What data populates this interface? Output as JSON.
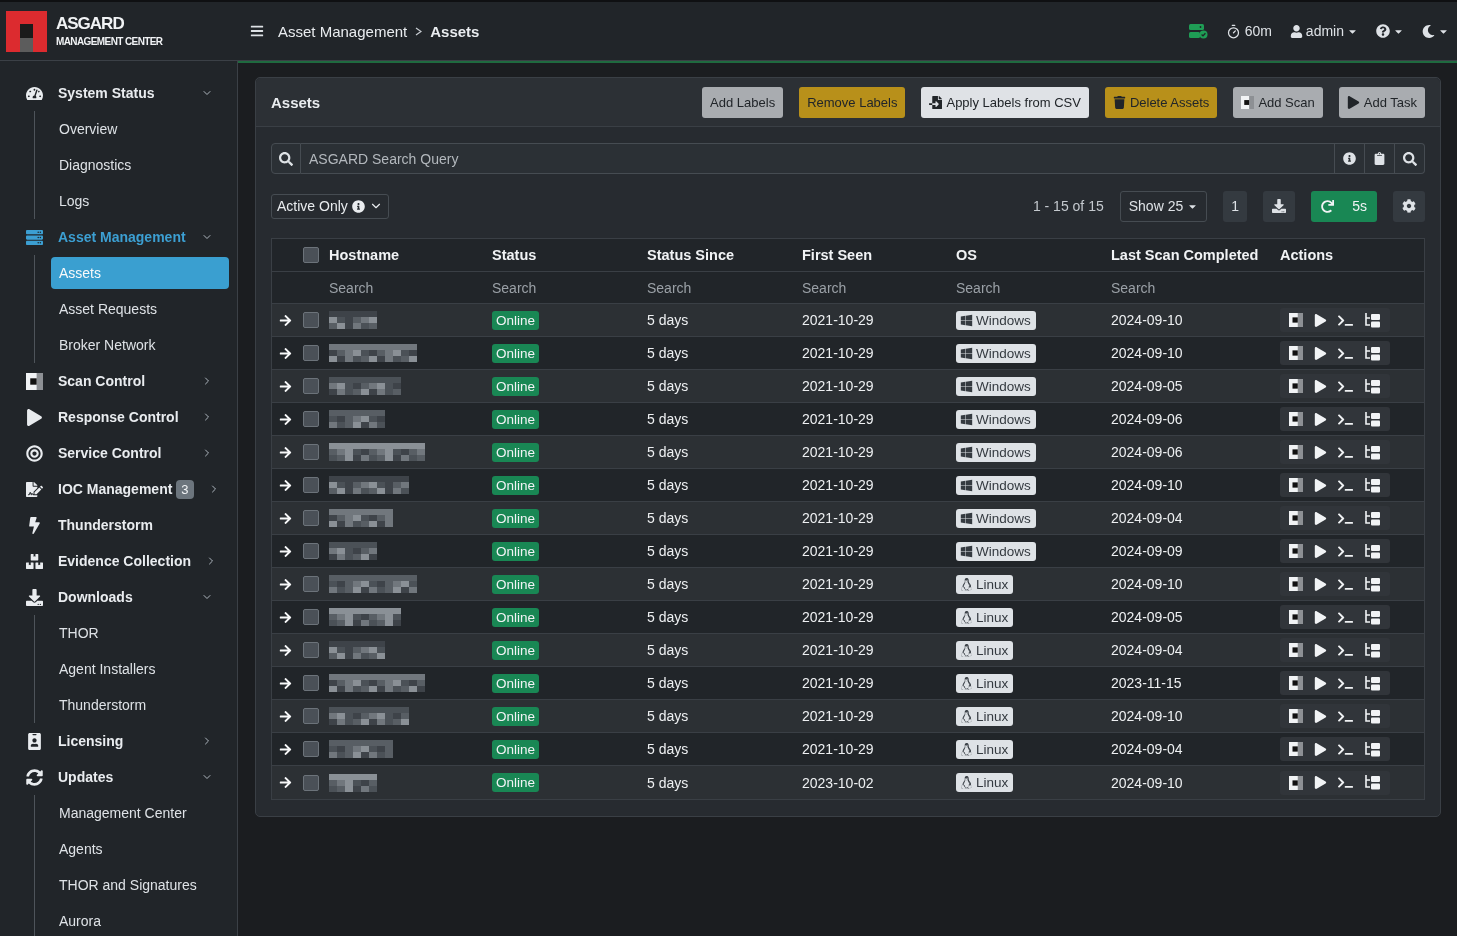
{
  "brand": {
    "title": "ASGARD",
    "subtitle": "MANAGEMENT CENTER"
  },
  "breadcrumb": [
    {
      "label": "Asset Management",
      "current": false
    },
    {
      "label": "Assets",
      "current": true
    }
  ],
  "header": {
    "timer": "60m",
    "user": "admin"
  },
  "sidebar": {
    "items": [
      {
        "label": "System Status",
        "selected": false,
        "expanded": true,
        "children": [
          {
            "label": "Overview",
            "selected": false
          },
          {
            "label": "Diagnostics",
            "selected": false
          },
          {
            "label": "Logs",
            "selected": false
          }
        ]
      },
      {
        "label": "Asset Management",
        "selected": true,
        "expanded": true,
        "children": [
          {
            "label": "Assets",
            "selected": true
          },
          {
            "label": "Asset Requests",
            "selected": false
          },
          {
            "label": "Broker Network",
            "selected": false
          }
        ]
      },
      {
        "label": "Scan Control",
        "selected": false,
        "expanded": false
      },
      {
        "label": "Response Control",
        "selected": false,
        "expanded": false
      },
      {
        "label": "Service Control",
        "selected": false,
        "expanded": false
      },
      {
        "label": "IOC Management",
        "selected": false,
        "expanded": false,
        "badge": "3"
      },
      {
        "label": "Thunderstorm",
        "selected": false
      },
      {
        "label": "Evidence Collection",
        "selected": false,
        "expanded": false
      },
      {
        "label": "Downloads",
        "selected": false,
        "expanded": true,
        "children": [
          {
            "label": "THOR",
            "selected": false
          },
          {
            "label": "Agent Installers",
            "selected": false
          },
          {
            "label": "Thunderstorm",
            "selected": false
          }
        ]
      },
      {
        "label": "Licensing",
        "selected": false,
        "expanded": false
      },
      {
        "label": "Updates",
        "selected": false,
        "expanded": true,
        "children": [
          {
            "label": "Management Center",
            "selected": false
          },
          {
            "label": "Agents",
            "selected": false
          },
          {
            "label": "THOR and Signatures",
            "selected": false
          },
          {
            "label": "Aurora",
            "selected": false
          }
        ]
      }
    ]
  },
  "panel": {
    "title": "Assets",
    "buttons": [
      {
        "label": "Add Labels",
        "kind": "secondary"
      },
      {
        "label": "Remove Labels",
        "kind": "warning"
      },
      {
        "label": "Apply Labels from CSV",
        "kind": "light"
      },
      {
        "label": "Delete Assets",
        "kind": "warning"
      },
      {
        "label": "Add Scan",
        "kind": "secondary"
      },
      {
        "label": "Add Task",
        "kind": "secondary"
      }
    ],
    "search": {
      "placeholder": "ASGARD Search Query"
    },
    "filter": {
      "value": "Active Only"
    },
    "range": "1 - 15 of 15",
    "page_size": "Show 25",
    "page": "1",
    "refresh": "5s"
  },
  "table": {
    "all_checked": false,
    "columns": [
      {
        "label": "Hostname",
        "placeholder": "Search"
      },
      {
        "label": "Status",
        "placeholder": "Search"
      },
      {
        "label": "Status Since",
        "placeholder": "Search"
      },
      {
        "label": "First Seen",
        "placeholder": "Search"
      },
      {
        "label": "OS",
        "placeholder": "Search"
      },
      {
        "label": "Last Scan Completed",
        "placeholder": "Search"
      },
      {
        "label": "Actions"
      }
    ],
    "rows": [
      {
        "checked": false,
        "status": "Online",
        "status_since": "5 days",
        "first_seen": "2021-10-29",
        "os": {
          "label": "Windows",
          "kind": "windows"
        },
        "last_scan": "2024-09-10"
      },
      {
        "checked": false,
        "status": "Online",
        "status_since": "5 days",
        "first_seen": "2021-10-29",
        "os": {
          "label": "Windows",
          "kind": "windows"
        },
        "last_scan": "2024-09-10"
      },
      {
        "checked": false,
        "status": "Online",
        "status_since": "5 days",
        "first_seen": "2021-10-29",
        "os": {
          "label": "Windows",
          "kind": "windows"
        },
        "last_scan": "2024-09-05"
      },
      {
        "checked": false,
        "status": "Online",
        "status_since": "5 days",
        "first_seen": "2021-10-29",
        "os": {
          "label": "Windows",
          "kind": "windows"
        },
        "last_scan": "2024-09-06"
      },
      {
        "checked": false,
        "status": "Online",
        "status_since": "5 days",
        "first_seen": "2021-10-29",
        "os": {
          "label": "Windows",
          "kind": "windows"
        },
        "last_scan": "2024-09-06"
      },
      {
        "checked": false,
        "status": "Online",
        "status_since": "5 days",
        "first_seen": "2021-10-29",
        "os": {
          "label": "Windows",
          "kind": "windows"
        },
        "last_scan": "2024-09-10"
      },
      {
        "checked": false,
        "status": "Online",
        "status_since": "5 days",
        "first_seen": "2021-10-29",
        "os": {
          "label": "Windows",
          "kind": "windows"
        },
        "last_scan": "2024-09-04"
      },
      {
        "checked": false,
        "status": "Online",
        "status_since": "5 days",
        "first_seen": "2021-10-29",
        "os": {
          "label": "Windows",
          "kind": "windows"
        },
        "last_scan": "2024-09-09"
      },
      {
        "checked": false,
        "status": "Online",
        "status_since": "5 days",
        "first_seen": "2021-10-29",
        "os": {
          "label": "Linux",
          "kind": "linux"
        },
        "last_scan": "2024-09-10"
      },
      {
        "checked": false,
        "status": "Online",
        "status_since": "5 days",
        "first_seen": "2021-10-29",
        "os": {
          "label": "Linux",
          "kind": "linux"
        },
        "last_scan": "2024-09-05"
      },
      {
        "checked": false,
        "status": "Online",
        "status_since": "5 days",
        "first_seen": "2021-10-29",
        "os": {
          "label": "Linux",
          "kind": "linux"
        },
        "last_scan": "2024-09-04"
      },
      {
        "checked": false,
        "status": "Online",
        "status_since": "5 days",
        "first_seen": "2021-10-29",
        "os": {
          "label": "Linux",
          "kind": "linux"
        },
        "last_scan": "2023-11-15"
      },
      {
        "checked": false,
        "status": "Online",
        "status_since": "5 days",
        "first_seen": "2021-10-29",
        "os": {
          "label": "Linux",
          "kind": "linux"
        },
        "last_scan": "2024-09-10"
      },
      {
        "checked": false,
        "status": "Online",
        "status_since": "5 days",
        "first_seen": "2021-10-29",
        "os": {
          "label": "Linux",
          "kind": "linux"
        },
        "last_scan": "2024-09-04"
      },
      {
        "checked": false,
        "status": "Online",
        "status_since": "5 days",
        "first_seen": "2023-10-02",
        "os": {
          "label": "Linux",
          "kind": "linux"
        },
        "last_scan": "2024-09-10"
      }
    ]
  }
}
